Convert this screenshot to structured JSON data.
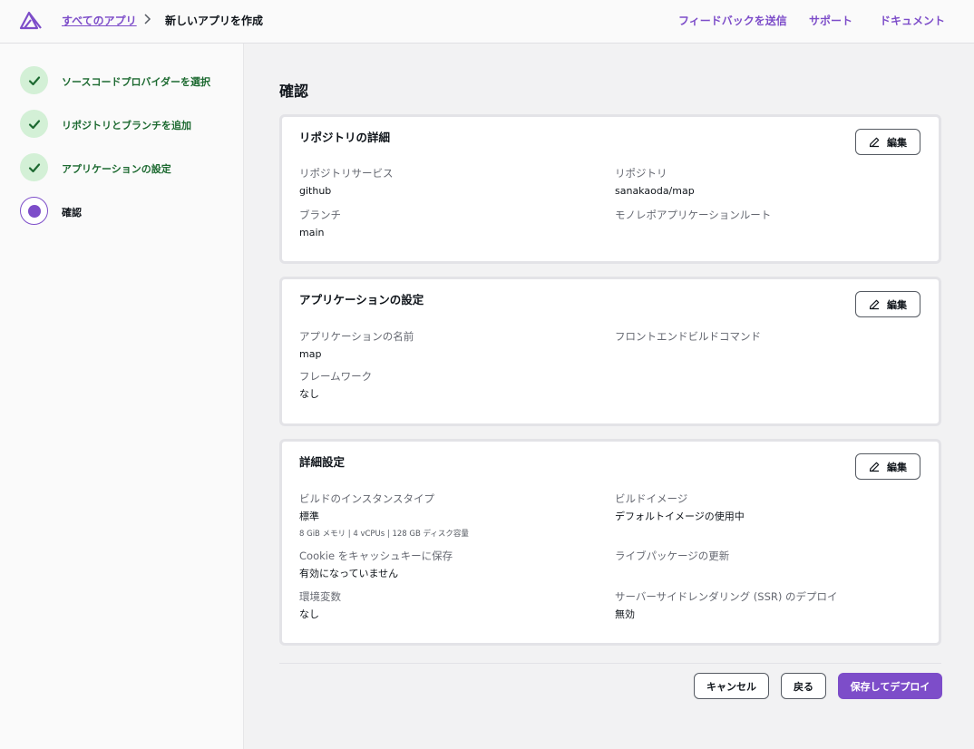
{
  "header": {
    "breadcrumb_root": "すべてのアプリ",
    "breadcrumb_current": "新しいアプリを作成",
    "links": {
      "feedback": "フィードバックを送信",
      "support": "サポート",
      "docs": "ドキュメント"
    }
  },
  "sidebar": {
    "steps": [
      {
        "label": "ソースコードプロバイダーを選択",
        "status": "complete"
      },
      {
        "label": "リポジトリとブランチを追加",
        "status": "complete"
      },
      {
        "label": "アプリケーションの設定",
        "status": "complete"
      },
      {
        "label": "確認",
        "status": "current"
      }
    ]
  },
  "main": {
    "title": "確認",
    "edit_label": "編集",
    "repo_card": {
      "title": "リポジトリの詳細",
      "service_label": "リポジトリサービス",
      "service_value": "github",
      "repo_label": "リポジトリ",
      "repo_value": "sanakaoda/map",
      "branch_label": "ブランチ",
      "branch_value": "main",
      "monorepo_label": "モノレポアプリケーションルート"
    },
    "app_card": {
      "title": "アプリケーションの設定",
      "name_label": "アプリケーションの名前",
      "name_value": "map",
      "frontend_label": "フロントエンドビルドコマンド",
      "framework_label": "フレームワーク",
      "framework_value": "なし"
    },
    "advanced_card": {
      "title": "詳細設定",
      "instance_label": "ビルドのインスタンスタイプ",
      "instance_value": "標準",
      "instance_sub": "8 GiB メモリ | 4 vCPUs | 128 GB ディスク容量",
      "image_label": "ビルドイメージ",
      "image_value": "デフォルトイメージの使用中",
      "cookie_label": "Cookie をキャッシュキーに保存",
      "cookie_value": "有効になっていません",
      "live_label": "ライブパッケージの更新",
      "env_label": "環境変数",
      "env_value": "なし",
      "ssr_label": "サーバーサイドレンダリング (SSR) のデプロイ",
      "ssr_value": "無効"
    },
    "buttons": {
      "cancel": "キャンセル",
      "back": "戻る",
      "save_deploy": "保存してデプロイ"
    }
  },
  "colors": {
    "accent": "#7d4dc9",
    "success": "#1d6a31",
    "success_bg": "#d3f0d6"
  }
}
